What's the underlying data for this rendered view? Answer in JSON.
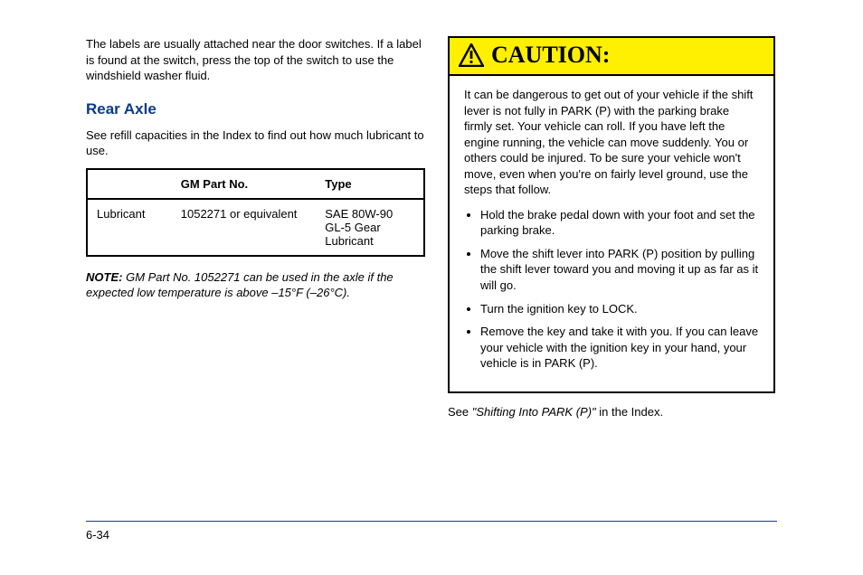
{
  "left": {
    "intro": "The labels are usually attached near the door switches. If a label is found at the switch, press the top of the switch to use the windshield washer fluid.",
    "heading": "Rear Axle",
    "ref": "See refill capacities in the Index to find out how much lubricant to use.",
    "table": {
      "headers": [
        "",
        "GM Part No.",
        "Type"
      ],
      "row": {
        "label": "Lubricant",
        "part": "1052271 or equivalent",
        "type": "SAE 80W-90 GL-5 Gear Lubricant"
      }
    },
    "note_label": "NOTE:",
    "note_text": "GM Part No. 1052271 can be used in the axle if the expected low temperature is above –15°F (–26°C)."
  },
  "right": {
    "caution_label": "CAUTION:",
    "lead": "It can be dangerous to get out of your vehicle if the shift lever is not fully in PARK (P) with the parking brake firmly set. Your vehicle can roll. If you have left the engine running, the vehicle can move suddenly. You or others could be injured. To be sure your vehicle won't move, even when you're on fairly level ground, use the steps that follow.",
    "bullets": [
      "Hold the brake pedal down with your foot and set the parking brake.",
      "Move the shift lever into PARK (P) position by pulling the shift lever toward you and moving it up as far as it will go.",
      "Turn the ignition key to LOCK.",
      "Remove the key and take it with you. If you can leave your vehicle with the ignition key in your hand, your vehicle is in PARK (P)."
    ],
    "xref_prefix": "See",
    "xref": "\"Shifting Into PARK (P)\"",
    "xref_suffix": "in the Index."
  },
  "page_number": "6-34"
}
